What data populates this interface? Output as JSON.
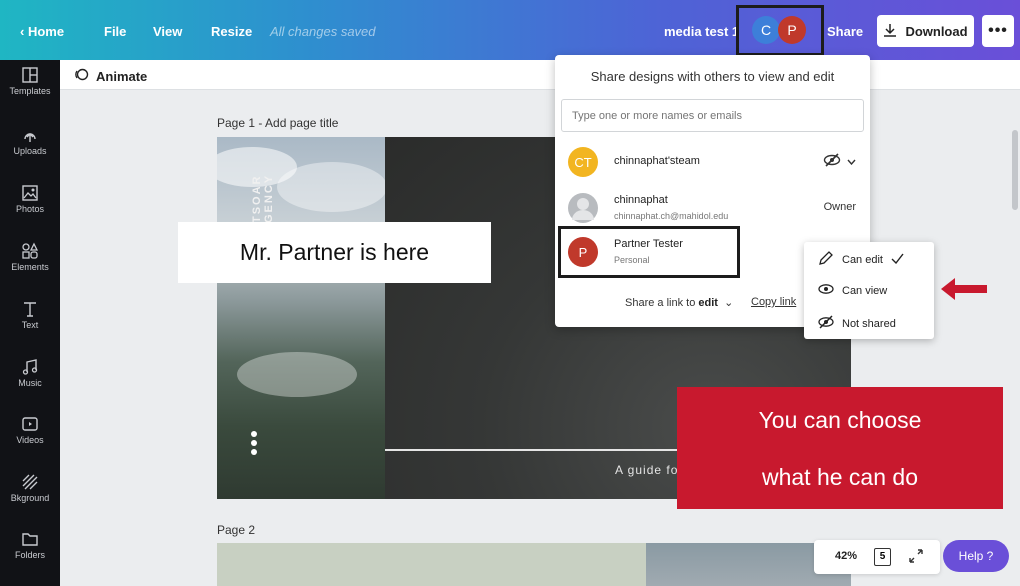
{
  "topbar": {
    "home_label": "Home",
    "file_label": "File",
    "view_label": "View",
    "resize_label": "Resize",
    "saved_status": "All changes saved",
    "doc_title": "media test 1",
    "collaborators": [
      {
        "initial": "C",
        "color": "#3d7fd9"
      },
      {
        "initial": "P",
        "color": "#c0392b"
      }
    ],
    "share_label": "Share",
    "download_label": "Download",
    "more_label": "•••"
  },
  "sidebar": {
    "items": [
      {
        "label": "Templates",
        "icon": "templates-icon"
      },
      {
        "label": "Uploads",
        "icon": "upload-icon"
      },
      {
        "label": "Photos",
        "icon": "photo-icon"
      },
      {
        "label": "Elements",
        "icon": "elements-icon"
      },
      {
        "label": "Text",
        "icon": "text-icon"
      },
      {
        "label": "Music",
        "icon": "music-icon"
      },
      {
        "label": "Videos",
        "icon": "video-icon"
      },
      {
        "label": "Bkground",
        "icon": "background-icon"
      },
      {
        "label": "Folders",
        "icon": "folder-icon"
      }
    ]
  },
  "subbar": {
    "animate_label": "Animate"
  },
  "canvas": {
    "page1_label": "Page 1 - Add page title",
    "page2_label": "Page 2",
    "design_vertical_text": "TSOAR\nGENCY",
    "design_guide_text": "A guide fo"
  },
  "callouts": {
    "partner_note": "Mr. Partner is here",
    "choose_line1": "You can choose",
    "choose_line2": "what he can do",
    "accent_red": "#c8192e"
  },
  "share_panel": {
    "title": "Share designs with others to view and edit",
    "input_placeholder": "Type one or more names or emails",
    "people": [
      {
        "initial": "CT",
        "name": "chinnaphat'steam",
        "sub": "",
        "right": "",
        "color": "#f2b521"
      },
      {
        "initial": "",
        "name": "chinnaphat",
        "sub": "chinnaphat.ch@mahidol.edu",
        "right": "Owner",
        "color": "#b8bbbf"
      },
      {
        "initial": "P",
        "name": "Partner Tester",
        "sub": "Personal",
        "right": "",
        "color": "#c0392b"
      }
    ],
    "link_prefix": "Share a link to",
    "link_mode": "edit",
    "copy_link_label": "Copy link"
  },
  "permission_menu": {
    "items": [
      {
        "label": "Can edit",
        "icon": "pencil-icon",
        "checked": true
      },
      {
        "label": "Can view",
        "icon": "eye-icon",
        "checked": false
      },
      {
        "label": "Not shared",
        "icon": "eye-slash-icon",
        "checked": false
      }
    ]
  },
  "bottom": {
    "zoom_label": "42%",
    "pages_count": "5",
    "help_label": "Help ?"
  }
}
